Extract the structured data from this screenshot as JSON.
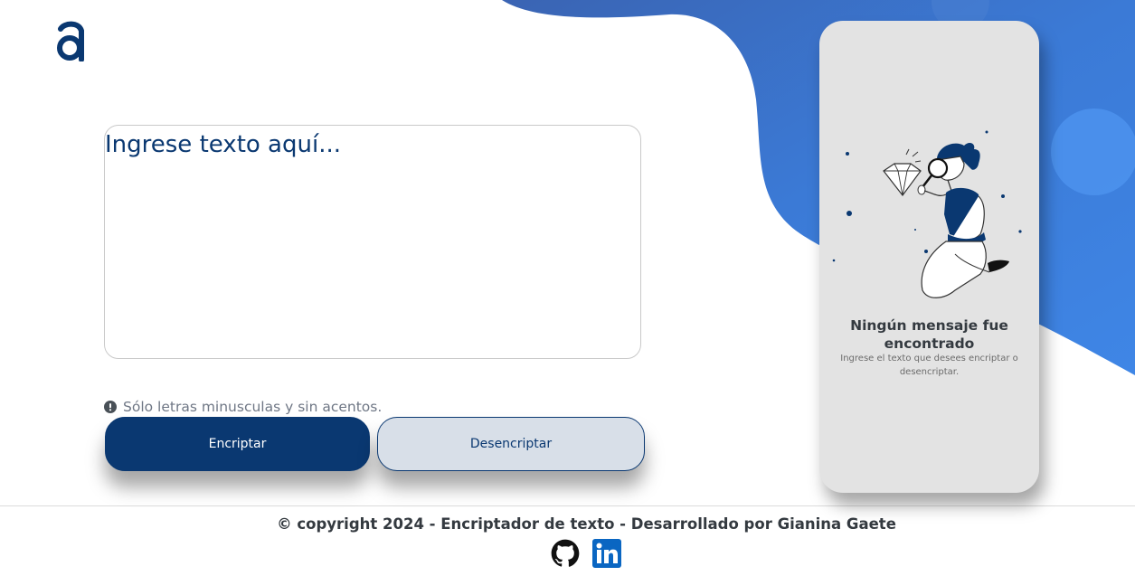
{
  "colors": {
    "primary": "#0a3871",
    "secondary_button_bg": "#d8dfe8",
    "card_bg": "#e3e3e3",
    "blob_dark": "#3a6fc4",
    "blob_light": "#4a8fe8",
    "linkedin": "#0a66c2"
  },
  "header": {
    "logo_icon": "alura-a-logo"
  },
  "input": {
    "placeholder": "Ingrese texto aquí..."
  },
  "hint": {
    "icon": "exclamation-circle-icon",
    "text": "Sólo letras minusculas y sin acentos."
  },
  "buttons": {
    "encrypt_label": "Encriptar",
    "decrypt_label": "Desencriptar"
  },
  "result": {
    "illustration": "person-with-magnifier-and-diamond",
    "title": "Ningún mensaje fue encontrado",
    "subtitle": "Ingrese el texto que desees encriptar o desencriptar."
  },
  "footer": {
    "copyright": "© copyright 2024 - Encriptador de texto - Desarrollado por Gianina Gaete",
    "links": [
      {
        "name": "github",
        "icon": "github-icon"
      },
      {
        "name": "linkedin",
        "icon": "linkedin-icon"
      }
    ]
  }
}
